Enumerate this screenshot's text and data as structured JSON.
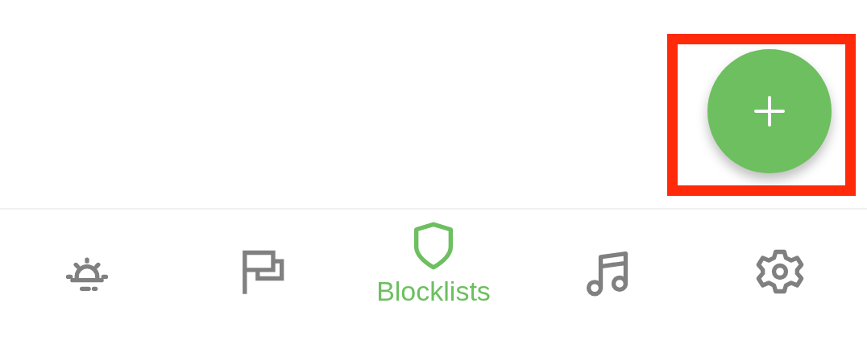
{
  "fab": {
    "highlighted": true
  },
  "nav": [
    {
      "kind": "alarm",
      "selected": false
    },
    {
      "kind": "flag",
      "selected": false
    },
    {
      "kind": "shield",
      "selected": true,
      "label": "Blocklists"
    },
    {
      "kind": "music",
      "selected": false
    },
    {
      "kind": "gear",
      "selected": false
    }
  ]
}
